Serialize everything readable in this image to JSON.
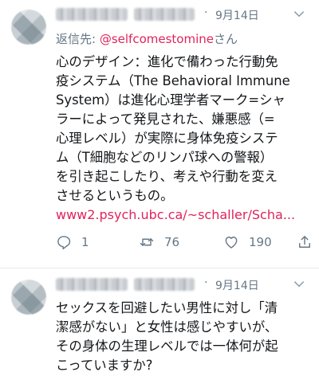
{
  "tweets": [
    {
      "date": "9月14日",
      "dot": "·",
      "reply_label": "返信先: ",
      "reply_handle": "@selfcomestomine",
      "reply_suffix": "さん",
      "lines": [
        "心のデザイン：進化で備わった行動免",
        "疫システム（The Behavioral Immune",
        "System）は進化心理学者マーク=シャ",
        "ラーによって発見された、嫌悪感（=",
        "心理レベル）が実際に身体免疫システ",
        "ム（T細胞などのリンパ球への警報）",
        "を引き起こしたり、考えや行動を変え",
        "させるというもの。"
      ],
      "link": "www2.psych.ubc.ca/~schaller/Scha...",
      "reply_count": "1",
      "retweet_count": "76",
      "like_count": "190"
    },
    {
      "date": "9月14日",
      "dot": "·",
      "lines": [
        "セックスを回避したい男性に対し「清",
        "潔感がない」と女性は感じやすいが、",
        "その身体の生理レベルでは一体何が起",
        "こっていますか?"
      ]
    }
  ],
  "icons": {
    "reply": "reply-icon",
    "retweet": "retweet-icon",
    "like": "heart-icon",
    "share": "share-icon",
    "menu": "chevron-down-icon"
  },
  "colors": {
    "text": "#14171a",
    "muted": "#657786",
    "link": "#e0245e",
    "divider": "#e6ecf0"
  }
}
